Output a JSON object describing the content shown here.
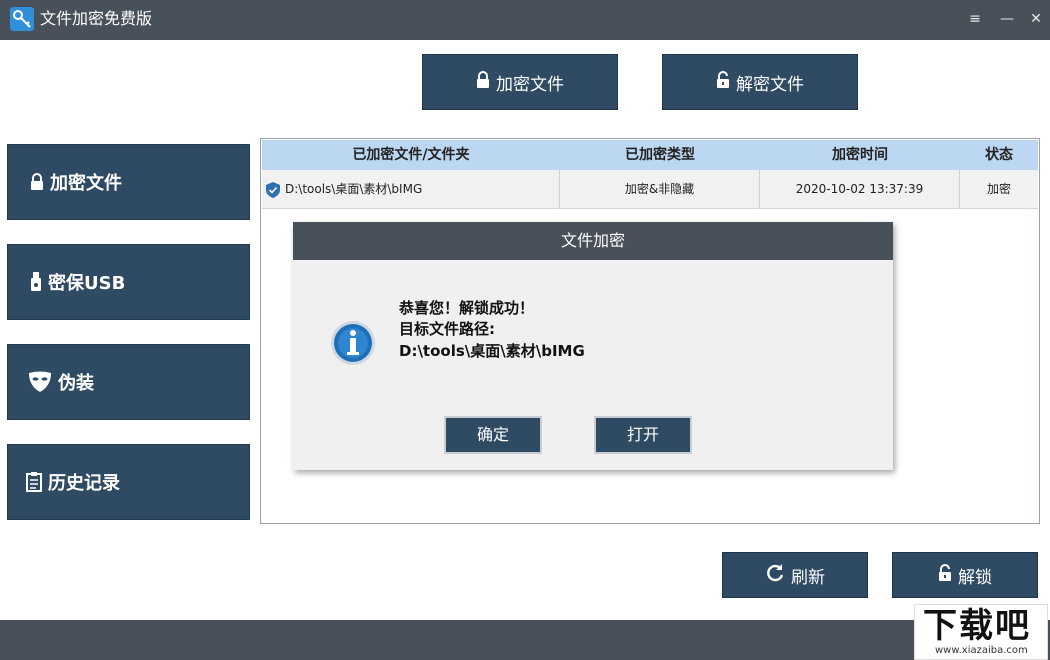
{
  "window": {
    "title": "文件加密免费版",
    "controls": {
      "menu": "≡",
      "minimize": "—",
      "close": "✕"
    }
  },
  "top_buttons": {
    "encrypt": "加密文件",
    "decrypt": "解密文件"
  },
  "sidebar": {
    "items": [
      {
        "label": "加密文件",
        "icon": "lock-icon"
      },
      {
        "label": "密保USB",
        "icon": "usb-icon"
      },
      {
        "label": "伪装",
        "icon": "mask-icon"
      },
      {
        "label": "历史记录",
        "icon": "clipboard-icon"
      }
    ]
  },
  "table": {
    "columns": [
      "已加密文件/文件夹",
      "已加密类型",
      "加密时间",
      "状态"
    ],
    "rows": [
      {
        "path": "D:\\tools\\桌面\\素材\\bIMG",
        "type": "加密&非隐藏",
        "time": "2020-10-02 13:37:39",
        "status": "加密"
      }
    ]
  },
  "bottom_buttons": {
    "refresh": "刷新",
    "unlock": "解锁"
  },
  "dialog": {
    "title": "文件加密",
    "line1": "恭喜您！解锁成功！",
    "line2": "目标文件路径:",
    "line3": "D:\\tools\\桌面\\素材\\bIMG",
    "ok": "确定",
    "open": "打开"
  },
  "watermark": {
    "big": "下载吧",
    "small": "www.xiazaiba.com"
  },
  "colors": {
    "button_bg": "#2f4a63",
    "titlebar_bg": "#48505a",
    "header_bg": "#bcd7f1",
    "info_blue": "#1f6fb8"
  }
}
